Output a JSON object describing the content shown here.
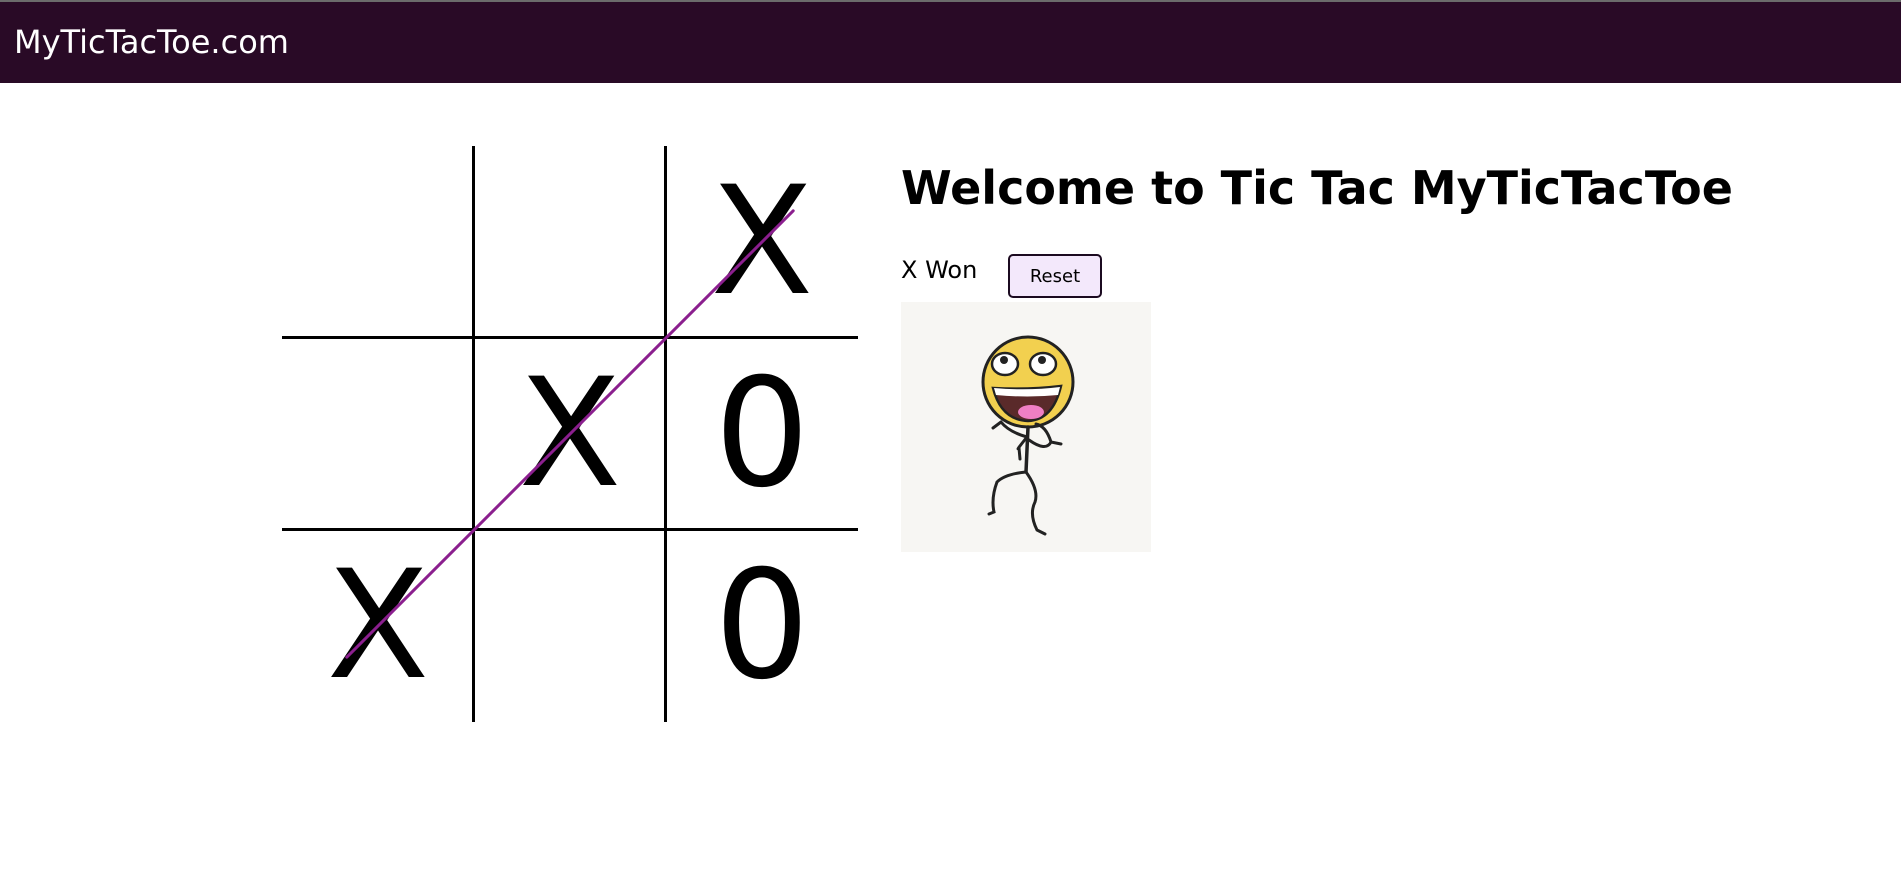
{
  "header": {
    "site_title": "MyTicTacToe.com",
    "background_color": "#290a26"
  },
  "board": {
    "cells": [
      "",
      "",
      "X",
      "",
      "X",
      "0",
      "X",
      "",
      "0"
    ],
    "winning_line": {
      "cells": [
        6,
        4,
        2
      ],
      "color": "#8b1f8e"
    }
  },
  "main": {
    "heading": "Welcome to Tic Tac MyTicTacToe",
    "status": "X Won",
    "reset_label": "Reset",
    "reset_button_color": "#f3e8fb",
    "image": {
      "icon": "happy-stick-figure-icon",
      "face_color": "#f2d04f"
    }
  }
}
